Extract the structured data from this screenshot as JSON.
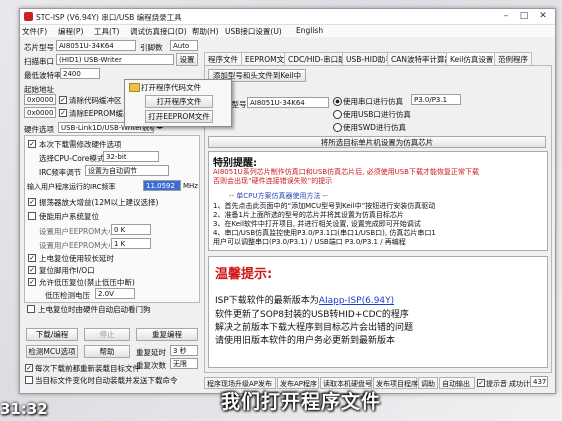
{
  "window": {
    "title": "STC-ISP (V6.94Y) 串口/USB 编程烧录工具",
    "menus": [
      "文件(F)",
      "编程(P)",
      "工具(T)",
      "调试仿真接口(D)",
      "帮助(H)",
      "USB接口设置(U)",
      "English"
    ]
  },
  "left": {
    "chip_label": "芯片型号",
    "chip_value": "AI8051U-34K64",
    "pin_label": "引脚数",
    "pin_value": "Auto",
    "port_label": "扫描串口",
    "port_value": "(HID1) USB-Writer",
    "settings_btn": "设置",
    "baud_label": "最低波特率",
    "baud_value": "2400",
    "addr_label": "起始地址",
    "addr1": "0x0000",
    "addr2": "0x0000",
    "clear_code": "清除代码缓冲区",
    "clear_eeprom": "清除EEPROM缓冲区",
    "hw_label": "硬件选项",
    "hw_value": "USB-Link1D/USB-Writer脱机",
    "options": [
      {
        "label": "本次下载需修改硬件选项",
        "checked": true
      },
      {
        "label": "选择CPU-Core模式",
        "value": "32-bit"
      },
      {
        "label": "IRC频率调节",
        "value": "设置为自动调节"
      },
      {
        "label": "输入用户程序运行的IRC频率",
        "value": "11.0592",
        "unit": "MHz"
      },
      {
        "label": "振荡器放大增益(12M以上建议选择)",
        "checked": true
      },
      {
        "label": "使能用户系统复位",
        "checked": false
      },
      {
        "label": "设置用户EEPROM大小",
        "value": "0 K"
      },
      {
        "label": "设置用户EEPROM大小",
        "value": "1 K"
      },
      {
        "label": "上电复位使用较长延时",
        "checked": true
      },
      {
        "label": "复位脚用作I/O口",
        "checked": true
      },
      {
        "label": "允许低压复位(禁止低压中断)",
        "checked": true
      },
      {
        "label": "低压检测电压",
        "value": "2.0V"
      },
      {
        "label": "上电复位时由硬件自动启动看门狗",
        "checked": false
      }
    ],
    "download_btn": "下载/编程",
    "stop_btn": "停止",
    "reprogram_btn": "重复编程",
    "detect_btn": "检测MCU选项",
    "help_btn": "帮助",
    "repeat_delay_label": "重复延时",
    "repeat_delay_value": "3 秒",
    "repeat_count_label": "重复次数",
    "repeat_count_value": "无限",
    "reload_check": "每次下载前都重新装载目标文件",
    "auto_load_check": "当目标文件变化时自动装载并发送下载命令"
  },
  "open_menu": {
    "heading": "打开程序代码文件",
    "item1": "打开程序文件",
    "item2": "打开EEPROM文件"
  },
  "tabs": [
    "程序文件",
    "EEPROM文件",
    "CDC/HID-串口助手",
    "USB-HID助手",
    "CAN波特率计算器",
    "Keil仿真设置",
    "范例程序"
  ],
  "right": {
    "add_btn": "添加型号和头文件到Keil中",
    "chip_label": "单片机型号",
    "chip_value": "AI8051U-34K64",
    "radio1": "使用串口进行仿真",
    "radio2": "使用USB口进行仿真",
    "radio3": "使用SWD进行仿真",
    "port_value": "P3.0/P3.1",
    "set_chip_btn": "将所选目标单片机设置为仿真芯片",
    "notice_title": "特别提醒:",
    "notice_lines": [
      "AI8051U系列芯片制作仿真口和USB仿真芯片后, 必须使用USB下载才能恢复正常下载",
      "否则会出现“硬件连接错误失败”的提示"
    ],
    "steps_title": "-- 单CPU方案仿真器使用方法 --",
    "steps": [
      "1、首先点击此页面中的“添加MCU型号到Keil中”按钮进行安装仿真驱动",
      "2、准备1片上面所选的型号的芯片并将其设置为仿真目标芯片",
      "3、在Keil软件中打开项目, 并进行相关设置, 设置完成即可开始调试",
      "4、串口/USB仿真监控使用P3.0/P3.1口(串口1/USB口), 仿真芯片串口1",
      "   用户可以调整串口(P3.0/P3.1) / USB端口 P3.0/P3.1 / 再编程"
    ],
    "tip_title": "温馨提示:",
    "tip_line1_prefix": "ISP下载软件的最新版本为",
    "tip_link": "AIapp-ISP(6.94Y)",
    "tip_lines": [
      "软件更新了SOP8封装的USB转HID+CDC的程序",
      "解决之前版本下载大程序到目标芯片会出错的问题",
      "请使用旧版本软件的用户务必更新到最新版本"
    ]
  },
  "statusbar": {
    "items": [
      "程序现场升级AP发布",
      "发布AP程序",
      "读取本机硬盘号",
      "发布项目程序",
      "调助",
      "自动输出",
      "提示音"
    ],
    "success_label": "成功计数",
    "success_value": "437",
    "clear_btn": "清零"
  },
  "caption": "我们打开程序文件",
  "video_time": "31:32"
}
